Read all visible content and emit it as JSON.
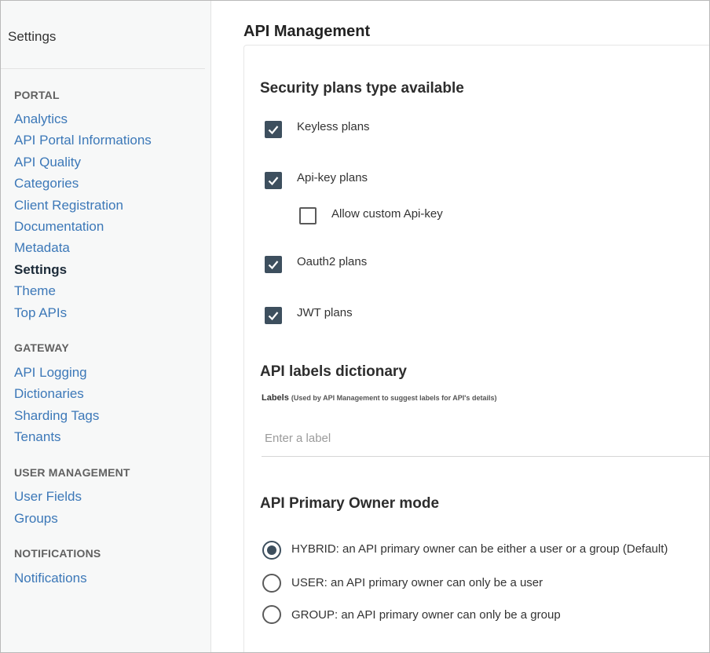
{
  "sidebar": {
    "title": "Settings",
    "sections": {
      "portal": {
        "header": "PORTAL",
        "items": [
          "Analytics",
          "API Portal Informations",
          "API Quality",
          "Categories",
          "Client Registration",
          "Documentation",
          "Metadata",
          "Settings",
          "Theme",
          "Top APIs"
        ]
      },
      "gateway": {
        "header": "GATEWAY",
        "items": [
          "API Logging",
          "Dictionaries",
          "Sharding Tags",
          "Tenants"
        ]
      },
      "user_management": {
        "header": "USER MANAGEMENT",
        "items": [
          "User Fields",
          "Groups"
        ]
      },
      "notifications": {
        "header": "NOTIFICATIONS",
        "items": [
          "Notifications"
        ]
      }
    },
    "active_item": "Settings"
  },
  "main": {
    "title": "API Management",
    "security_plans": {
      "title": "Security plans type available",
      "options": [
        {
          "label": "Keyless plans",
          "checked": true
        },
        {
          "label": "Api-key plans",
          "checked": true
        },
        {
          "label": "Allow custom Api-key",
          "checked": false
        },
        {
          "label": "Oauth2 plans",
          "checked": true
        },
        {
          "label": "JWT plans",
          "checked": true
        }
      ]
    },
    "labels_dictionary": {
      "title": "API labels dictionary",
      "field_label": "Labels",
      "field_hint": "(Used by API Management to suggest labels for API's details)",
      "placeholder": "Enter a label",
      "value": ""
    },
    "primary_owner": {
      "title": "API Primary Owner mode",
      "options": [
        {
          "label": "HYBRID: an API primary owner can be either a user or a group (Default)",
          "selected": true
        },
        {
          "label": "USER: an API primary owner can only be a user",
          "selected": false
        },
        {
          "label": "GROUP: an API primary owner can only be a group",
          "selected": false
        }
      ]
    }
  },
  "colors": {
    "link": "#3c78b8",
    "active_link": "#1c2b39",
    "control": "#3d4f5e",
    "sidebar_bg": "#f7f8f8"
  }
}
